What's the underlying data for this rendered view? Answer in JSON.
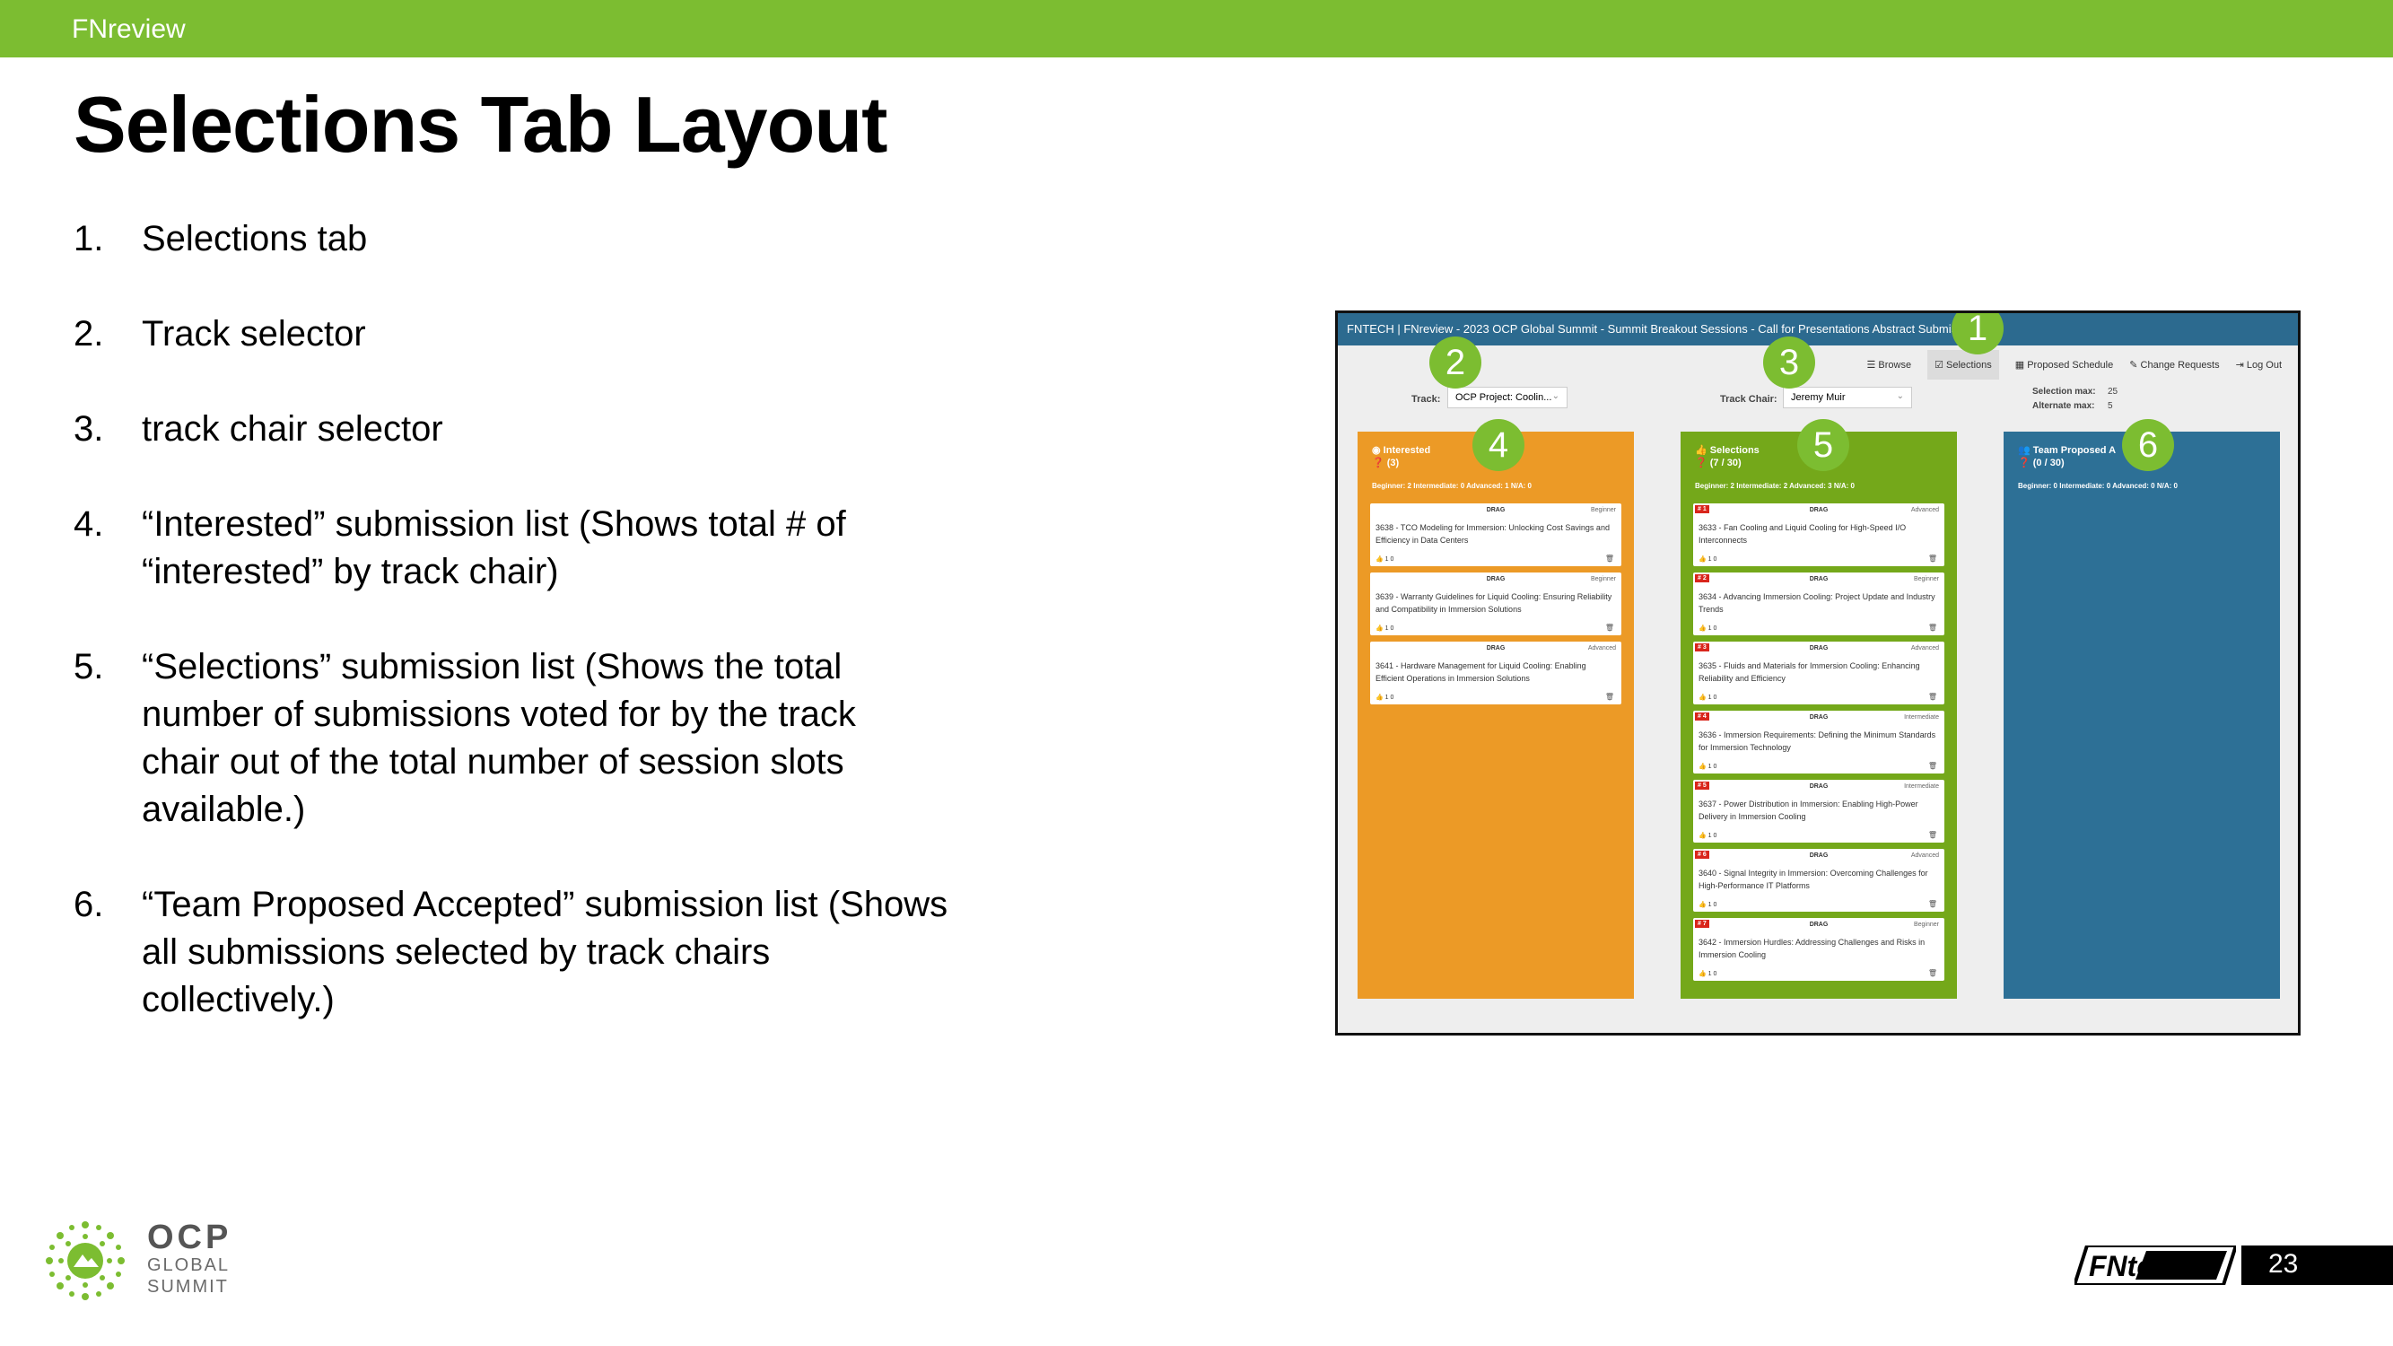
{
  "topbar": {
    "title": "FNreview"
  },
  "slide": {
    "title": "Selections Tab Layout",
    "page_number": "23"
  },
  "list": [
    {
      "num": "1.",
      "text": "Selections tab"
    },
    {
      "num": "2.",
      "text": "Track selector"
    },
    {
      "num": "3.",
      "text": "track chair selector"
    },
    {
      "num": "4.",
      "text": "“Interested” submission list (Shows total # of “interested” by track chair)"
    },
    {
      "num": "5.",
      "text": "“Selections” submission list (Shows the total number of submissions voted for by the track chair out of the total number of session slots available.)"
    },
    {
      "num": "6.",
      "text": "“Team Proposed Accepted” submission list (Shows all submissions selected by track chairs collectively.)"
    }
  ],
  "screenshot": {
    "header": "FNTECH | FNreview - 2023 OCP Global Summit - Summit Breakout Sessions - Call for Presentations Abstract Submissions",
    "nav": [
      "Browse",
      "Selections",
      "Proposed Schedule",
      "Change Requests",
      "Log Out"
    ],
    "track_label": "Track:",
    "track_value": "OCP Project: Coolin...",
    "chair_label": "Track Chair:",
    "chair_value": "Jeremy Muir",
    "selection_max_label": "Selection max:",
    "selection_max_value": "25",
    "alternate_max_label": "Alternate max:",
    "alternate_max_value": "5",
    "columns": {
      "interested": {
        "title": "Interested",
        "count": "(3)",
        "stats": "Beginner: 2   Intermediate: 0   Advanced: 1   N/A: 0",
        "cards": [
          {
            "drag": "DRAG",
            "level": "Beginner",
            "text": "3638 - TCO Modeling for Immersion: Unlocking Cost Savings and Efficiency in Data Centers",
            "foot": "1   0"
          },
          {
            "drag": "DRAG",
            "level": "Beginner",
            "text": "3639 - Warranty Guidelines for Liquid Cooling: Ensuring Reliability and Compatibility in Immersion Solutions",
            "foot": "1   0"
          },
          {
            "drag": "DRAG",
            "level": "Advanced",
            "text": "3641 - Hardware Management for Liquid Cooling: Enabling Efficient Operations in Immersion Solutions",
            "foot": "1   0"
          }
        ]
      },
      "selections": {
        "title": "Selections",
        "count": "(7 / 30)",
        "stats": "Beginner: 2   Intermediate: 2   Advanced: 3   N/A: 0",
        "cards": [
          {
            "rank": "# 1",
            "drag": "DRAG",
            "level": "Advanced",
            "text": "3633 - Fan Cooling and Liquid Cooling for High-Speed I/O Interconnects",
            "foot": "1   0"
          },
          {
            "rank": "# 2",
            "drag": "DRAG",
            "level": "Beginner",
            "text": "3634 - Advancing Immersion Cooling: Project Update and Industry Trends",
            "foot": "1   0"
          },
          {
            "rank": "# 3",
            "drag": "DRAG",
            "level": "Advanced",
            "text": "3635 - Fluids and Materials for Immersion Cooling: Enhancing Reliability and Efficiency",
            "foot": "1   0"
          },
          {
            "rank": "# 4",
            "drag": "DRAG",
            "level": "Intermediate",
            "text": "3636 - Immersion Requirements: Defining the Minimum Standards for Immersion Technology",
            "foot": "1   0"
          },
          {
            "rank": "# 5",
            "drag": "DRAG",
            "level": "Intermediate",
            "text": "3637 - Power Distribution in Immersion: Enabling High-Power Delivery in Immersion Cooling",
            "foot": "1   0"
          },
          {
            "rank": "# 6",
            "drag": "DRAG",
            "level": "Advanced",
            "text": "3640 - Signal Integrity in Immersion: Overcoming Challenges for High-Performance IT Platforms",
            "foot": "1   0"
          },
          {
            "rank": "# 7",
            "drag": "DRAG",
            "level": "Beginner",
            "text": "3642 - Immersion Hurdles: Addressing Challenges and Risks in Immersion Cooling",
            "foot": "1   0"
          }
        ]
      },
      "team": {
        "title": "Team Proposed A",
        "count": "(0 / 30)",
        "stats": "Beginner: 0   Intermediate: 0   Advanced: 0   N/A: 0"
      }
    },
    "badges": [
      "1",
      "2",
      "3",
      "4",
      "5",
      "6"
    ]
  },
  "footer": {
    "ocp_big": "OCP",
    "ocp_line1": "GLOBAL",
    "ocp_line2": "SUMMIT",
    "fntech_logo": "FNtech"
  },
  "colors": {
    "brand_green": "#7cbd31",
    "interested": "#ec9a26",
    "selections": "#74a81a",
    "team": "#2d7096",
    "header_blue": "#2c6a8f"
  }
}
